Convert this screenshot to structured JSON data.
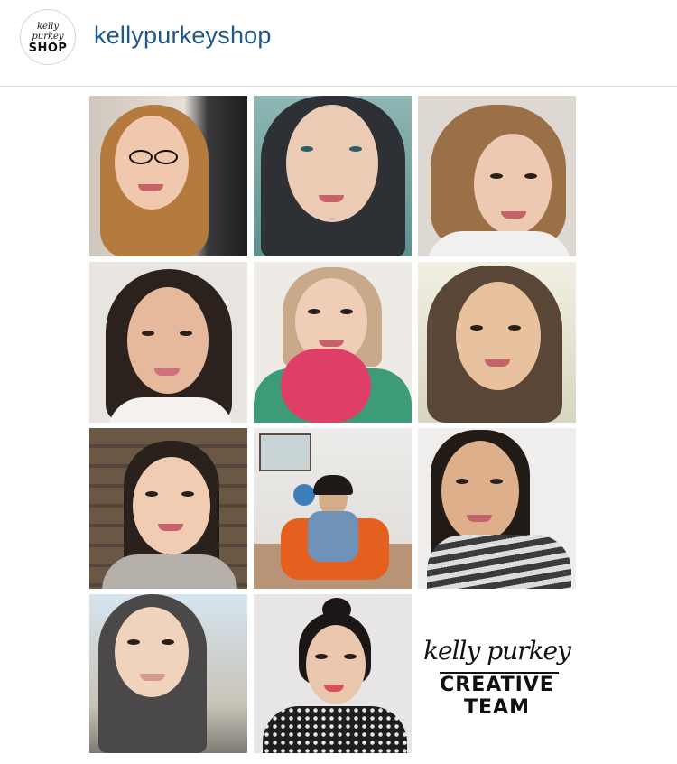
{
  "header": {
    "username": "kellypurkeyshop",
    "avatar": {
      "script": "kelly purkey",
      "shop": "SHOP"
    }
  },
  "post": {
    "brand_tile": {
      "script": "kelly purkey",
      "line1": "CREATIVE",
      "line2": "TEAM"
    }
  },
  "colors": {
    "username": "#1f5788",
    "divider": "#dbdbdb"
  }
}
